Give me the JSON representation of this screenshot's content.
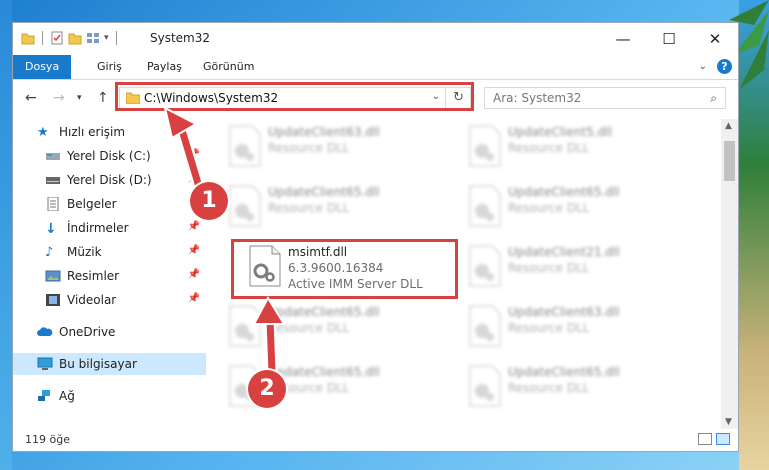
{
  "window": {
    "title": "System32",
    "controls": {
      "minimize": "—",
      "maximize": "☐",
      "close": "✕"
    }
  },
  "ribbon": {
    "tabs": [
      {
        "label": "Dosya",
        "active": true
      },
      {
        "label": "Giriş",
        "active": false
      },
      {
        "label": "Paylaş",
        "active": false
      },
      {
        "label": "Görünüm",
        "active": false
      }
    ]
  },
  "navigation": {
    "address": "C:\\Windows\\System32",
    "search_placeholder": "Ara: System32"
  },
  "sidebar": {
    "items": [
      {
        "label": "Hızlı erişim",
        "icon": "star-icon",
        "pinned": false,
        "selected": false
      },
      {
        "label": "Yerel Disk (C:)",
        "icon": "drive-icon",
        "pinned": true,
        "selected": false
      },
      {
        "label": "Yerel Disk (D:)",
        "icon": "drive-icon",
        "pinned": true,
        "selected": false
      },
      {
        "label": "Belgeler",
        "icon": "documents-icon",
        "pinned": true,
        "selected": false
      },
      {
        "label": "İndirmeler",
        "icon": "download-icon",
        "pinned": true,
        "selected": false
      },
      {
        "label": "Müzik",
        "icon": "music-icon",
        "pinned": true,
        "selected": false
      },
      {
        "label": "Resimler",
        "icon": "pictures-icon",
        "pinned": true,
        "selected": false
      },
      {
        "label": "Videolar",
        "icon": "videos-icon",
        "pinned": true,
        "selected": false
      },
      {
        "label": "OneDrive",
        "icon": "cloud-icon",
        "pinned": false,
        "selected": false
      },
      {
        "label": "Bu bilgisayar",
        "icon": "computer-icon",
        "pinned": false,
        "selected": true
      },
      {
        "label": "Ağ",
        "icon": "network-icon",
        "pinned": false,
        "selected": false
      }
    ]
  },
  "files": [
    {
      "name": "UpdateClient63.dll",
      "sub1": "Resource DLL",
      "sub2": "",
      "blurred": true
    },
    {
      "name": "UpdateClient5.dll",
      "sub1": "Resource DLL",
      "sub2": "",
      "blurred": true
    },
    {
      "name": "UpdateClient65.dll",
      "sub1": "Resource DLL",
      "sub2": "",
      "blurred": true
    },
    {
      "name": "UpdateClient65.dll",
      "sub1": "Resource DLL",
      "sub2": "",
      "blurred": true
    },
    {
      "name": "msimtf.dll",
      "sub1": "6.3.9600.16384",
      "sub2": "Active IMM Server DLL",
      "blurred": false
    },
    {
      "name": "UpdateClient21.dll",
      "sub1": "Resource DLL",
      "sub2": "",
      "blurred": true
    },
    {
      "name": "UpdateClient65.dll",
      "sub1": "Resource DLL",
      "sub2": "",
      "blurred": true
    },
    {
      "name": "UpdateClient63.dll",
      "sub1": "Resource DLL",
      "sub2": "",
      "blurred": true
    },
    {
      "name": "UpdateClient65.dll",
      "sub1": "Resource DLL",
      "sub2": "",
      "blurred": true
    },
    {
      "name": "UpdateClient65.dll",
      "sub1": "Resource DLL",
      "sub2": "",
      "blurred": true
    }
  ],
  "status": {
    "count": "119 öğe"
  },
  "markers": {
    "one": "1",
    "two": "2"
  },
  "colors": {
    "accent": "#1979ca",
    "highlight": "#d94040",
    "selected": "#cce8ff"
  }
}
